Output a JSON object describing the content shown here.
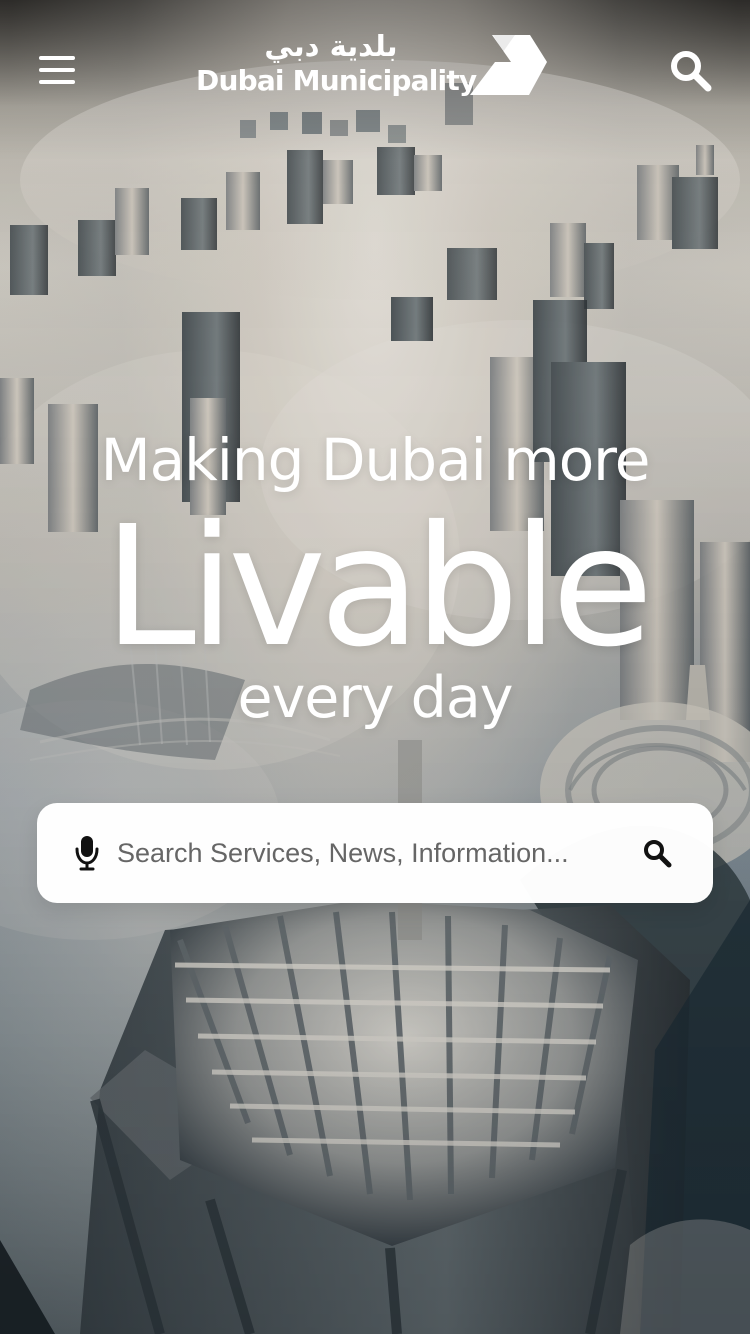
{
  "header": {
    "logo": {
      "arabic_text": "بلدية دبي",
      "english_text": "Dubai Municipality"
    },
    "menu_icon": "hamburger-icon",
    "search_icon": "search-icon"
  },
  "hero": {
    "line1": "Making Dubai more",
    "line2": "Livable",
    "line3": "every day"
  },
  "search": {
    "placeholder": "Search Services, News, Information...",
    "mic_icon": "microphone-icon",
    "submit_icon": "search-icon"
  },
  "colors": {
    "text_on_image": "#ffffff",
    "search_card_bg": "#ffffff",
    "icon_dark": "#111111",
    "placeholder": "#666666"
  }
}
